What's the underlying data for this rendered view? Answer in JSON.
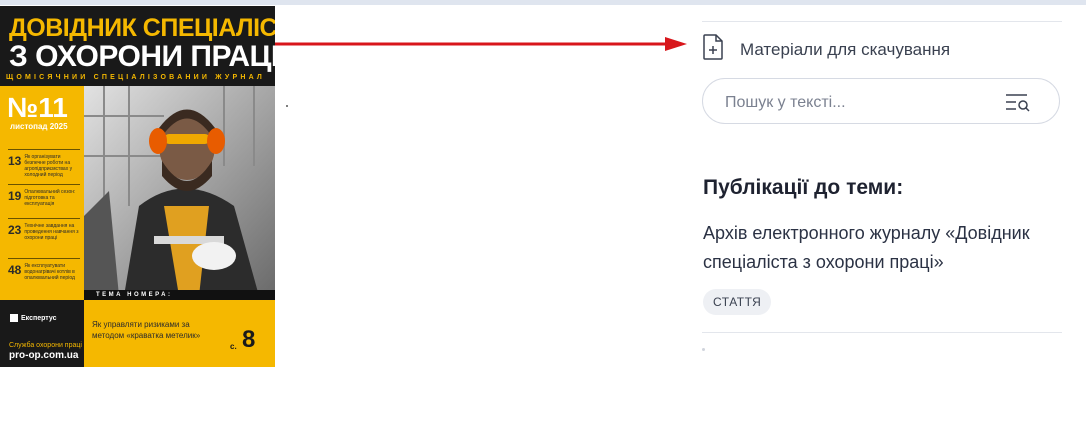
{
  "cover": {
    "title_line1": "ДОВІДНИК СПЕЦІАЛІСТА",
    "title_line2": "З ОХОРОНИ ПРАЦІ",
    "tagline": "ЩОМІСЯЧНИЙ СПЕЦІАЛІЗОВАНИЙ ЖУРНАЛ",
    "issue_number": "№11",
    "issue_date": "листопад 2025",
    "contents": [
      {
        "page": "13",
        "text": "Як організувати безпечне роботи на агропідприємствах у холодний період"
      },
      {
        "page": "19",
        "text": "Опалювальний сезон: підготовка та експлуатація"
      },
      {
        "page": "23",
        "text": "Технічне завдання на проведення навчання з охорони праці"
      },
      {
        "page": "48",
        "text": "Як експлуатувати водонагрівачі котлів в опалювальний період"
      }
    ],
    "theme_label": "ТЕМА НОМЕРА:",
    "feature_text": "Як управляти ризиками за методом «краватка метелик»",
    "feature_page_prefix": "с.",
    "feature_page": "8",
    "brand": "Експертус",
    "service": "Служба охорони праці",
    "site": "pro-op.com.ua",
    "colors": {
      "accent": "#f5b800",
      "dark": "#191919"
    }
  },
  "annotation": {
    "arrow_color": "#d8161b"
  },
  "sidebar": {
    "download": {
      "icon": "file-plus-icon",
      "label": "Матеріали для скачування"
    },
    "search": {
      "placeholder": "Пошук у тексті...",
      "value": "",
      "icon": "search-list-icon"
    },
    "related": {
      "heading": "Публікації до теми:",
      "link": "Архів електронного журналу «Довідник спеціаліста з охорони праці»",
      "badge": "СТАТТЯ"
    }
  }
}
